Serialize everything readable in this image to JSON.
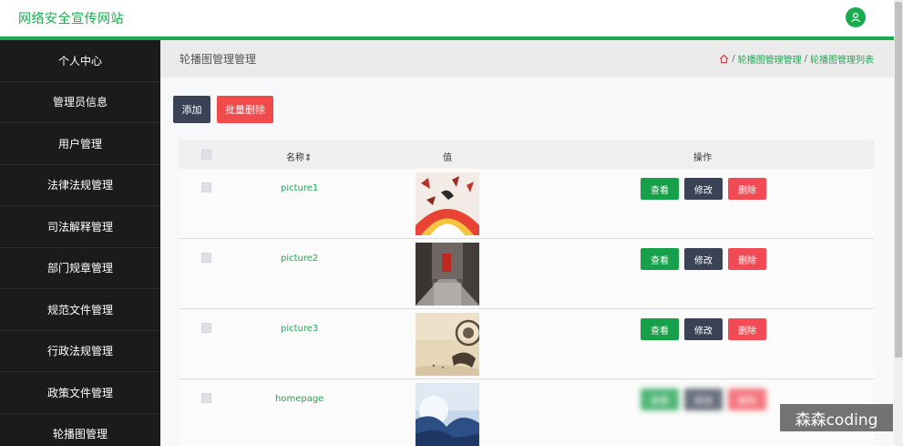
{
  "header": {
    "brand": "网络安全宣传网站"
  },
  "sidebar": {
    "items": [
      {
        "label": "个人中心"
      },
      {
        "label": "管理员信息"
      },
      {
        "label": "用户管理"
      },
      {
        "label": "法律法规管理"
      },
      {
        "label": "司法解释管理"
      },
      {
        "label": "部门规章管理"
      },
      {
        "label": "规范文件管理"
      },
      {
        "label": "行政法规管理"
      },
      {
        "label": "政策文件管理"
      },
      {
        "label": "轮播图管理"
      }
    ]
  },
  "breadcrumb": {
    "page_title": "轮播图管理管理",
    "level1": "轮播图管理管理",
    "level2": "轮播图管理列表",
    "separator": "/"
  },
  "toolbar": {
    "add_label": "添加",
    "batch_delete_label": "批量删除"
  },
  "table": {
    "headers": {
      "name": "名称",
      "sort_glyph": "⇕",
      "value": "值",
      "actions": "操作"
    },
    "rows": [
      {
        "name": "picture1"
      },
      {
        "name": "picture2"
      },
      {
        "name": "picture3"
      },
      {
        "name": "homepage"
      }
    ],
    "actions": {
      "view": "查看",
      "edit": "修改",
      "delete": "删除"
    }
  },
  "watermark": "森森coding",
  "colors": {
    "brand": "#1aab51",
    "dark_button": "#3a4255",
    "danger": "#f24b55",
    "sidebar_bg": "#1b1b1b"
  }
}
